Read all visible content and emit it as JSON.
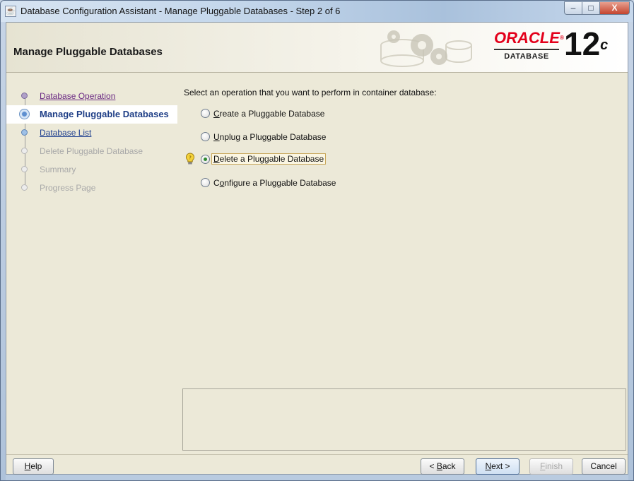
{
  "window": {
    "title": "Database Configuration Assistant - Manage Pluggable Databases - Step 2 of 6",
    "minimize_label": "–",
    "maximize_label": "□",
    "close_label": "X"
  },
  "header": {
    "title": "Manage Pluggable Databases",
    "logo_word": "ORACLE",
    "logo_sub": "DATABASE",
    "version": "12",
    "version_suffix": "c"
  },
  "nav": {
    "items": [
      {
        "label": "Database Operation",
        "state": "done"
      },
      {
        "label": "Manage Pluggable Databases",
        "state": "current"
      },
      {
        "label": "Database List",
        "state": "link"
      },
      {
        "label": "Delete Pluggable Database",
        "state": "disabled"
      },
      {
        "label": "Summary",
        "state": "disabled"
      },
      {
        "label": "Progress Page",
        "state": "disabled"
      }
    ]
  },
  "content": {
    "prompt": "Select an operation that you want to perform in container database:",
    "options": [
      {
        "mnemonic": "C",
        "rest": "reate a Pluggable Database",
        "checked": false
      },
      {
        "mnemonic": "U",
        "rest": "nplug a Pluggable Database",
        "checked": false
      },
      {
        "mnemonic": "D",
        "rest": "elete a Pluggable Database",
        "checked": true
      },
      {
        "prefix": "C",
        "mnemonic": "o",
        "rest": "nfigure a Pluggable Database",
        "checked": false
      }
    ],
    "hint_icon": "lightbulb-icon",
    "message": ""
  },
  "footer": {
    "help": {
      "mnemonic": "H",
      "rest": "elp"
    },
    "back": {
      "prefix": "< ",
      "mnemonic": "B",
      "rest": "ack"
    },
    "next": {
      "mnemonic": "N",
      "rest": "ext >"
    },
    "finish": {
      "mnemonic": "F",
      "rest": "inish"
    },
    "cancel": "Cancel"
  },
  "colors": {
    "oracle_red": "#e3001b",
    "visited_link": "#6b2a83",
    "current_step": "#1e3e86",
    "disabled_text": "#a9a9a9",
    "panel_bg": "#ece9d8"
  }
}
